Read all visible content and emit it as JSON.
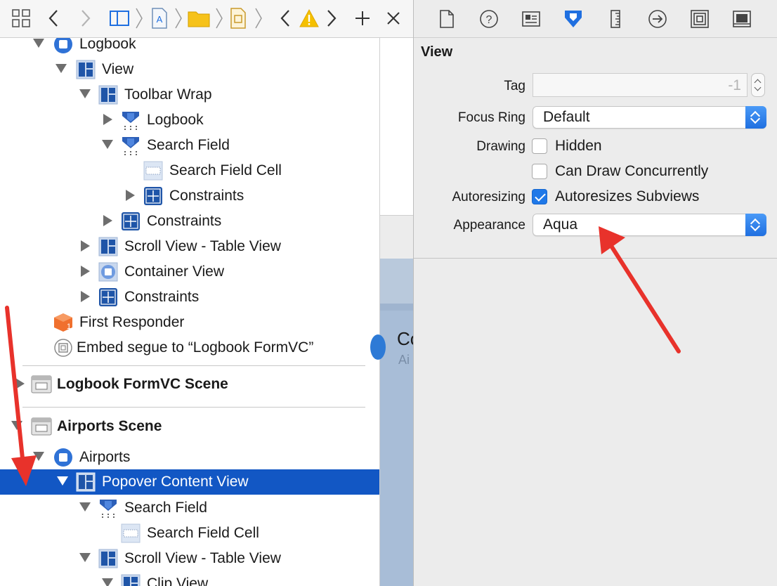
{
  "outline": {
    "rows": [
      {
        "label": "Logbook",
        "icon": "view-controller-icon"
      },
      {
        "label": "View",
        "icon": "view-icon"
      },
      {
        "label": "Toolbar Wrap",
        "icon": "view-icon"
      },
      {
        "label": "Logbook",
        "icon": "custom-view-icon"
      },
      {
        "label": "Search Field",
        "icon": "custom-view-icon"
      },
      {
        "label": "Search Field Cell",
        "icon": "cell-icon"
      },
      {
        "label": "Constraints",
        "icon": "constraints-icon"
      },
      {
        "label": "Constraints",
        "icon": "constraints-icon"
      },
      {
        "label": "Scroll View - Table View",
        "icon": "view-icon"
      },
      {
        "label": "Container View",
        "icon": "container-view-icon"
      },
      {
        "label": "Constraints",
        "icon": "constraints-icon"
      },
      {
        "label": "First Responder",
        "icon": "first-responder-icon"
      },
      {
        "label": "Embed segue to “Logbook FormVC”",
        "icon": "segue-icon"
      },
      {
        "label": "Logbook FormVC Scene",
        "icon": "scene-icon"
      },
      {
        "label": "Airports Scene",
        "icon": "scene-icon"
      },
      {
        "label": "Airports",
        "icon": "view-controller-icon"
      },
      {
        "label": "Popover Content View",
        "icon": "view-icon"
      },
      {
        "label": "Search Field",
        "icon": "custom-view-icon"
      },
      {
        "label": "Search Field Cell",
        "icon": "cell-icon"
      },
      {
        "label": "Scroll View - Table View",
        "icon": "view-icon"
      },
      {
        "label": "Clip View",
        "icon": "view-icon"
      }
    ],
    "selected_row": "Popover Content View"
  },
  "canvas_peek": {
    "text1": "Co",
    "text2": "Ai"
  },
  "inspector": {
    "section_title": "View",
    "tag_label": "Tag",
    "tag_value": "-1",
    "focus_ring_label": "Focus Ring",
    "focus_ring_value": "Default",
    "drawing_label": "Drawing",
    "hidden_label": "Hidden",
    "hidden_checked": false,
    "concurrent_label": "Can Draw Concurrently",
    "concurrent_checked": false,
    "autoresizing_label": "Autoresizing",
    "autoresizes_label": "Autoresizes Subviews",
    "autoresizes_checked": true,
    "appearance_label": "Appearance",
    "appearance_value": "Aqua"
  },
  "colors": {
    "selection": "#1257c4",
    "accent": "#1f78e8",
    "annotation": "#e8322b"
  }
}
